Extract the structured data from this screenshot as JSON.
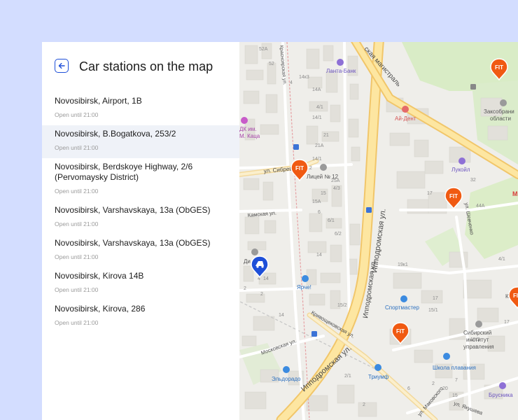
{
  "panel": {
    "title": "Car stations on the map",
    "back_icon": "arrow-left-icon"
  },
  "stations": [
    {
      "name": "Novosibirsk, Airport, 1B",
      "hours": "Open until 21:00"
    },
    {
      "name": "Novosibirsk, B.Bogatkova, 253/2",
      "hours": "Open until 21:00"
    },
    {
      "name": "Novosibirsk, Berdskoye Highway, 2/6 (Pervomaysky District)",
      "hours": "Open until 21:00"
    },
    {
      "name": "Novosibirsk, Varshavskaya, 13a (ObGES)",
      "hours": "Open until 21:00"
    },
    {
      "name": "Novosibirsk, Varshavskaya, 13a (ObGES)",
      "hours": "Open until 21:00"
    },
    {
      "name": "Novosibirsk, Kirova 14B",
      "hours": "Open until 21:00"
    },
    {
      "name": "Novosibirsk, Kirova, 286",
      "hours": "Open until 21:00"
    }
  ],
  "selected_index": 1,
  "map": {
    "marker_label": "FIT",
    "streets": {
      "ippodromskaya_upper": "Ипподромская ул.",
      "ippodromskaya_mid": "Ипподромская ул.",
      "ippodromskaya_lower": "Ипподромская ул.",
      "magistral": "ская магистраль",
      "sibrevkoma": "ул. Сибрев",
      "kamskaya": "Камская ул.",
      "moskovskaya": "Московская ул.",
      "krivoshchekovskaya": "Кривощековская ул.",
      "shevchenko": "ул. Шевченко",
      "makovskogo": "ул. Маковского",
      "yakusheva": "ул. Якушева",
      "krasnooktyabrskaya": "Красноярская ул."
    },
    "pois": {
      "lanta_bank": "Ланта-Банк",
      "ai_dent": "Ай-Дент",
      "lukoil": "Лукойл",
      "lyceum": "Лицей № 12",
      "yarche": "Ярче!",
      "sportmaster": "Спортмастер",
      "eldorado": "Эльдорадо",
      "triumf": "Триумф",
      "shkola_plavaniya": "Школа плавания",
      "brusnika": "Брусника",
      "zaksobranie_1": "Заксобрани",
      "zaksobranie_2": "области",
      "institute_1": "Сибирский",
      "institute_2": "институт",
      "institute_3": "управления",
      "dk_1": "ДК им.",
      "dk_2": "М. Каца",
      "di": "Ди",
      "k": "К",
      "m": "М"
    },
    "house_numbers": [
      "52A",
      "52",
      "14к3",
      "4",
      "14A",
      "4/1",
      "14/1",
      "21",
      "21A",
      "14/1",
      "12",
      "25A",
      "4/3",
      "15",
      "15A",
      "6",
      "6/1",
      "6/2",
      "17",
      "44A",
      "32",
      "15/2",
      "15/1",
      "17",
      "19к1",
      "4/1",
      "2",
      "7",
      "20",
      "17",
      "2/1",
      "14",
      "4",
      "15/2",
      "6",
      "15",
      "14",
      "14",
      "2",
      "2",
      "2"
    ]
  }
}
